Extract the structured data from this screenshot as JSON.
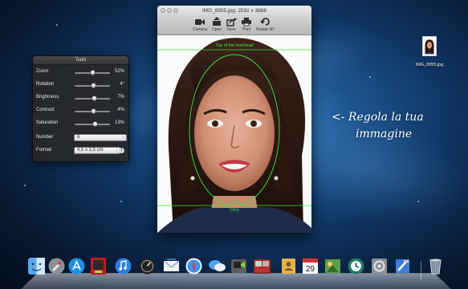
{
  "tools_panel": {
    "title": "Tools",
    "sliders": [
      {
        "label": "Zoom",
        "value": "52%",
        "level": 0.52
      },
      {
        "label": "Rotation",
        "value": "4°",
        "level": 0.54
      },
      {
        "label": "Brightness",
        "value": "7%",
        "level": 0.55
      },
      {
        "label": "Contrast",
        "value": "4%",
        "level": 0.53
      },
      {
        "label": "Saturation",
        "value": "13%",
        "level": 0.58
      }
    ],
    "number": {
      "label": "Number",
      "value": "6"
    },
    "format": {
      "label": "Format",
      "value": "4,5 x 3,5 cm"
    }
  },
  "window": {
    "title": "IMG_8955.jpg: 2592 x 3888",
    "toolbar": [
      "Camera",
      "Open",
      "Save",
      "Print",
      "Rotate 90°"
    ],
    "guide_top_label": "Top of the forehead",
    "guide_bottom_label": "Chin"
  },
  "annotation": {
    "line1": "<- Regola la tua",
    "line2": "immagine"
  },
  "desktop_file": {
    "label": "IMG_8955.jpg"
  },
  "dock": {
    "items": [
      "finder-icon",
      "launchpad-icon",
      "app-store-icon",
      "photo-booth-icon",
      "itunes-icon",
      "dashboard-icon",
      "mail-icon",
      "safari-icon",
      "messages-icon",
      "facetime-icon",
      "photo-app-icon",
      "contacts-icon",
      "calendar-icon",
      "iphoto-icon",
      "time-machine-icon",
      "system-preferences-icon",
      "xcode-icon",
      "trash-icon"
    ],
    "calendar_day": "29"
  }
}
